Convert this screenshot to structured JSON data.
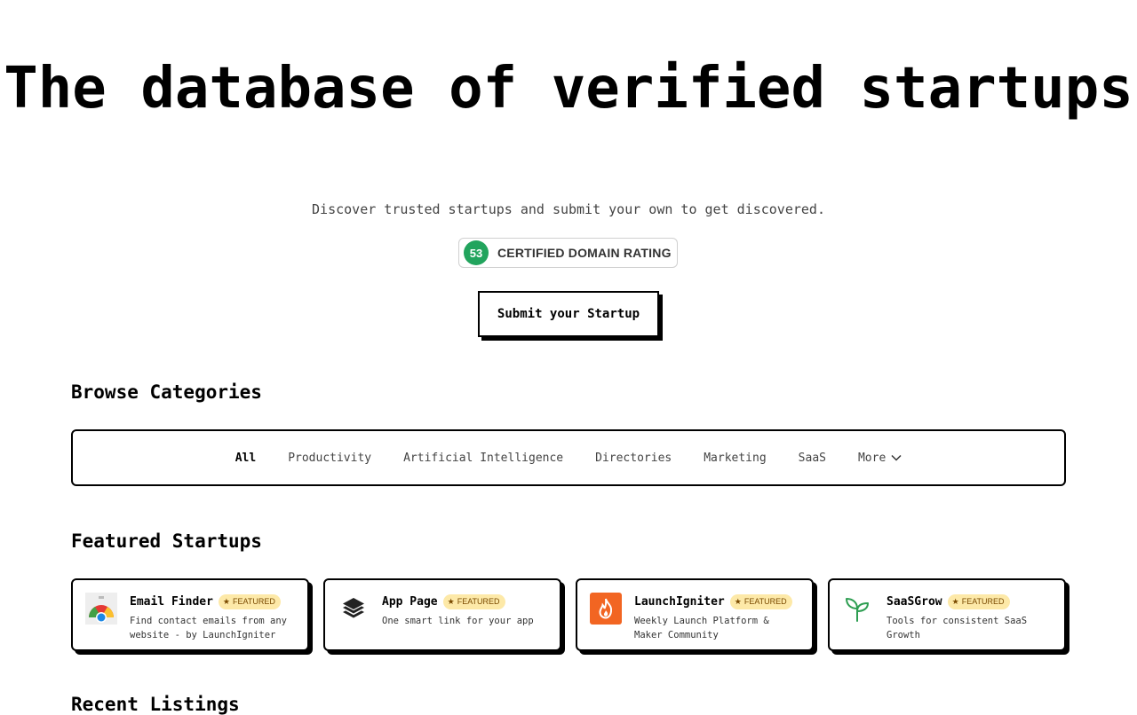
{
  "hero": {
    "title": "The database of verified startups",
    "subtitle": "Discover trusted startups and submit your own to get discovered."
  },
  "rating": {
    "value": "53",
    "label": "CERTIFIED DOMAIN RATING",
    "color": "#22a45d"
  },
  "submit_label": "Submit your Startup",
  "categories": {
    "heading": "Browse Categories",
    "items": [
      {
        "label": "All",
        "active": true
      },
      {
        "label": "Productivity"
      },
      {
        "label": "Artificial Intelligence"
      },
      {
        "label": "Directories"
      },
      {
        "label": "Marketing"
      },
      {
        "label": "SaaS"
      },
      {
        "label": "More",
        "icon": "chevron-down-icon"
      }
    ]
  },
  "featured": {
    "heading": "Featured Startups",
    "badge_label": "FEATURED",
    "cards": [
      {
        "name": "Email Finder",
        "desc": "Find contact emails from any website - by LaunchIgniter",
        "icon": "chrome-extension-icon"
      },
      {
        "name": "App Page",
        "desc": "One smart link for your app",
        "icon": "layers-icon"
      },
      {
        "name": "LaunchIgniter",
        "desc": "Weekly Launch Platform & Maker Community",
        "icon": "flame-icon"
      },
      {
        "name": "SaaSGrow",
        "desc": "Tools for consistent SaaS Growth",
        "icon": "sprout-icon"
      }
    ]
  },
  "recent": {
    "heading": "Recent Listings"
  }
}
